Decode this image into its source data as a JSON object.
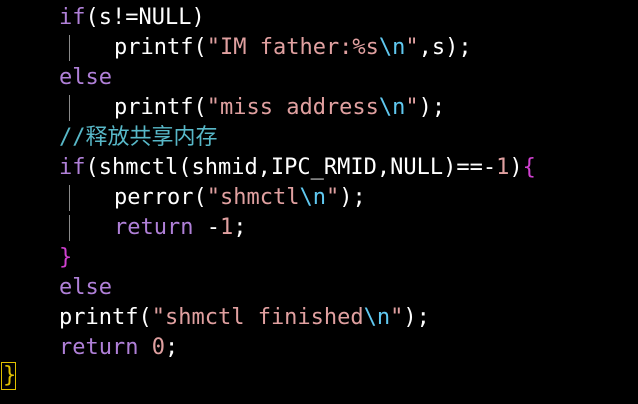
{
  "palette": {
    "background": "#000000",
    "keyword": "#b080d8",
    "identifier": "#ffffff",
    "function": "#ffffff",
    "string": "#e0a0a0",
    "escape": "#60c8f0",
    "comment": "#58b8c8",
    "number": "#e0a0a0",
    "brace": "#d040d0",
    "cursor_border": "#e0c000",
    "cursor_text": "#e0c000"
  },
  "lines": [
    {
      "tokens": [
        {
          "t": "if",
          "c": "keyword"
        },
        {
          "t": "(s!=NULL)",
          "c": "identifier"
        }
      ]
    },
    {
      "tokens": [
        {
          "t": "printf",
          "c": "function"
        },
        {
          "t": "(",
          "c": "identifier"
        },
        {
          "t": "\"IM father:%s",
          "c": "string"
        },
        {
          "t": "\\n",
          "c": "escape"
        },
        {
          "t": "\"",
          "c": "string"
        },
        {
          "t": ",s);",
          "c": "identifier"
        }
      ]
    },
    {
      "tokens": [
        {
          "t": "else",
          "c": "keyword"
        }
      ]
    },
    {
      "tokens": [
        {
          "t": "printf",
          "c": "function"
        },
        {
          "t": "(",
          "c": "identifier"
        },
        {
          "t": "\"miss address",
          "c": "string"
        },
        {
          "t": "\\n",
          "c": "escape"
        },
        {
          "t": "\"",
          "c": "string"
        },
        {
          "t": ");",
          "c": "identifier"
        }
      ]
    },
    {
      "tokens": [
        {
          "t": "//释放共享内存",
          "c": "comment"
        }
      ]
    },
    {
      "tokens": [
        {
          "t": "if",
          "c": "keyword"
        },
        {
          "t": "(shmctl(shmid,IPC_RMID,NULL)==-",
          "c": "identifier"
        },
        {
          "t": "1",
          "c": "number"
        },
        {
          "t": ")",
          "c": "identifier"
        },
        {
          "t": "{",
          "c": "brace"
        }
      ]
    },
    {
      "tokens": [
        {
          "t": "perror",
          "c": "function"
        },
        {
          "t": "(",
          "c": "identifier"
        },
        {
          "t": "\"shmctl",
          "c": "string"
        },
        {
          "t": "\\n",
          "c": "escape"
        },
        {
          "t": "\"",
          "c": "string"
        },
        {
          "t": ");",
          "c": "identifier"
        }
      ]
    },
    {
      "tokens": [
        {
          "t": "return",
          "c": "keyword"
        },
        {
          "t": " -",
          "c": "identifier"
        },
        {
          "t": "1",
          "c": "number"
        },
        {
          "t": ";",
          "c": "identifier"
        }
      ]
    },
    {
      "tokens": [
        {
          "t": "}",
          "c": "brace"
        }
      ]
    },
    {
      "tokens": [
        {
          "t": "else",
          "c": "keyword"
        }
      ]
    },
    {
      "tokens": [
        {
          "t": "printf",
          "c": "function"
        },
        {
          "t": "(",
          "c": "identifier"
        },
        {
          "t": "\"shmctl finished",
          "c": "string"
        },
        {
          "t": "\\n",
          "c": "escape"
        },
        {
          "t": "\"",
          "c": "string"
        },
        {
          "t": ");",
          "c": "identifier"
        }
      ]
    },
    {
      "tokens": [
        {
          "t": "return",
          "c": "keyword"
        },
        {
          "t": " ",
          "c": "identifier"
        },
        {
          "t": "0",
          "c": "number"
        },
        {
          "t": ";",
          "c": "identifier"
        }
      ]
    }
  ],
  "cursor_char": "}"
}
